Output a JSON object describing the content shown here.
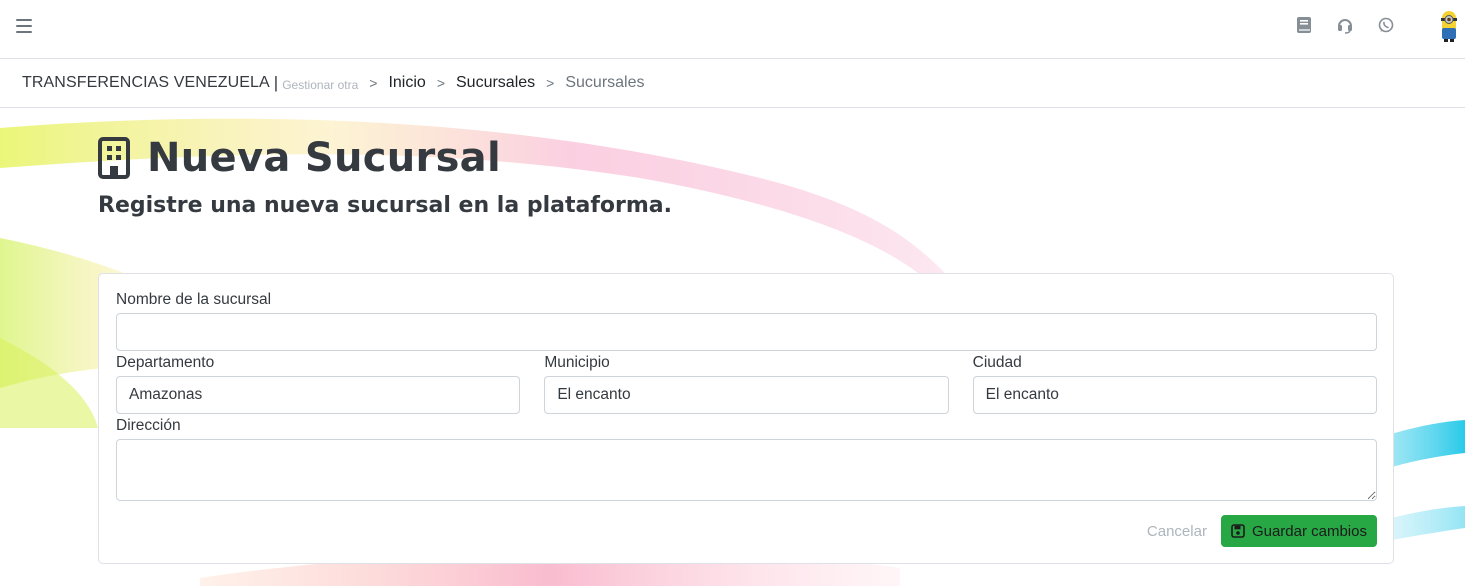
{
  "header": {
    "menu_icon": "hamburger-icon",
    "icons": [
      "book-icon",
      "headset-icon",
      "whatsapp-icon"
    ],
    "avatar": "minion-avatar"
  },
  "breadcrumb": {
    "brand": "TRANSFERENCIAS VENEZUELA",
    "separator": "|",
    "manage_other": "Gestionar otra",
    "items": [
      "Inicio",
      "Sucursales",
      "Sucursales"
    ],
    "chevron": ">"
  },
  "page": {
    "icon": "building-icon",
    "title": "Nueva Sucursal",
    "subtitle": "Registre una nueva sucursal en la plataforma."
  },
  "form": {
    "name": {
      "label": "Nombre de la sucursal",
      "value": ""
    },
    "department": {
      "label": "Departamento",
      "value": "Amazonas"
    },
    "municipality": {
      "label": "Municipio",
      "value": "El encanto"
    },
    "city": {
      "label": "Ciudad",
      "value": "El encanto"
    },
    "address": {
      "label": "Dirección",
      "value": ""
    },
    "cancel_label": "Cancelar",
    "save_label": "Guardar cambios",
    "save_icon": "save-icon"
  },
  "colors": {
    "primary_green": "#28a745",
    "text_dark": "#343a40",
    "muted": "#6c757d"
  }
}
